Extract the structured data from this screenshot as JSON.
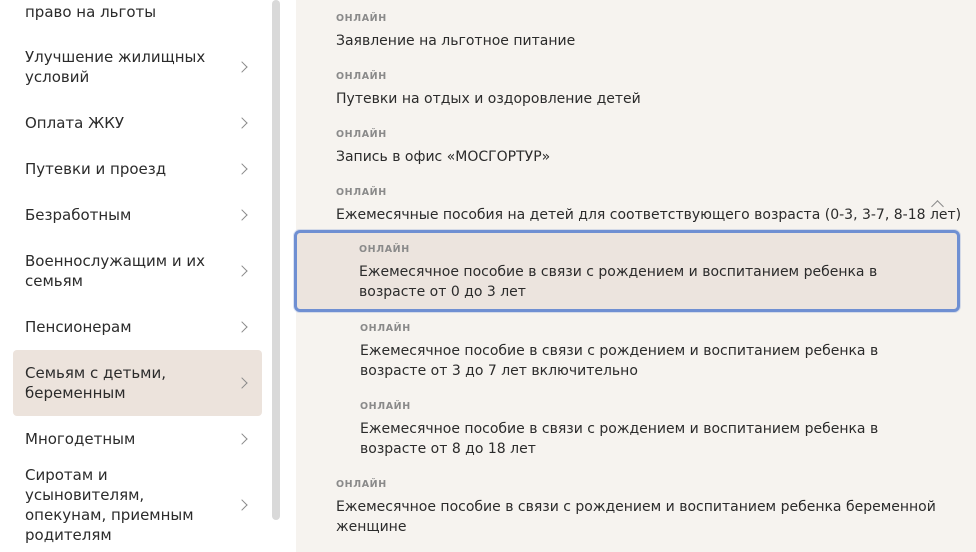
{
  "sidebar": {
    "items": [
      {
        "label": "право на льготы"
      },
      {
        "label": "Улучшение жилищных условий"
      },
      {
        "label": "Оплата ЖКУ"
      },
      {
        "label": "Путевки и проезд"
      },
      {
        "label": "Безработным"
      },
      {
        "label": "Военнослужащим и их семьям"
      },
      {
        "label": "Пенсионерам"
      },
      {
        "label": "Семьям с детьми, беременным"
      },
      {
        "label": "Многодетным"
      },
      {
        "label": "Сиротам и усыновителям, опекунам, приемным родителям"
      }
    ],
    "active_index": 7
  },
  "main": {
    "services": [
      {
        "tag": "ОНЛАЙН",
        "title": "Заявление на льготное питание"
      },
      {
        "tag": "ОНЛАЙН",
        "title": "Путевки на отдых и оздоровление детей"
      },
      {
        "tag": "ОНЛАЙН",
        "title": "Запись в офис «МОСГОРТУР»"
      },
      {
        "tag": "ОНЛАЙН",
        "title": "Ежемесячные пособия на детей для соответствующего возраста (0-3, 3-7, 8-18 лет)"
      },
      {
        "tag": "ОНЛАЙН",
        "title": "Ежемесячное пособие в связи с рождением и воспитанием ребенка в возрасте от 0 до 3 лет"
      },
      {
        "tag": "ОНЛАЙН",
        "title": "Ежемесячное пособие в связи с рождением и воспитанием ребенка в возрасте от 3 до 7 лет включительно"
      },
      {
        "tag": "ОНЛАЙН",
        "title": "Ежемесячное пособие в связи с рождением и воспитанием ребенка в возрасте от 8 до 18 лет"
      },
      {
        "tag": "ОНЛАЙН",
        "title": "Ежемесячное пособие в связи с рождением и воспитанием ребенка беременной женщине"
      }
    ]
  },
  "colors": {
    "active_bg": "#ece3dc",
    "main_bg": "#f6f3ef",
    "focus_border": "#6f8fd2"
  }
}
